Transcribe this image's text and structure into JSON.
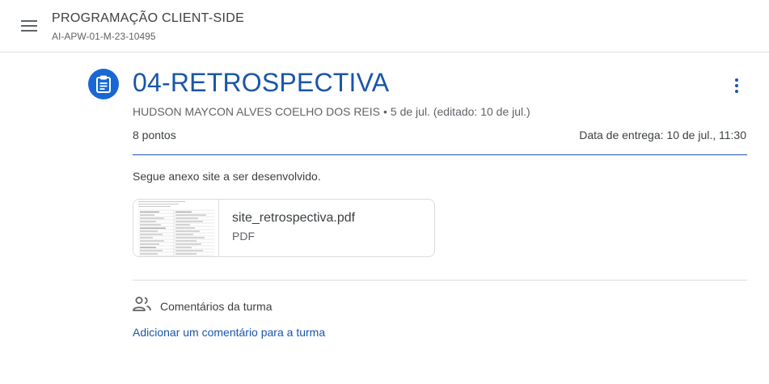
{
  "header": {
    "course_title": "PROGRAMAÇÃO CLIENT-SIDE",
    "course_code": "AI-APW-01-M-23-10495",
    "menu_icon": "hamburger-menu-icon"
  },
  "assignment": {
    "icon": "assignment-clipboard-icon",
    "title": "04-RETROSPECTIVA",
    "author": "HUDSON MAYCON ALVES COELHO DOS REIS",
    "separator": "•",
    "date": "5 de jul. (editado: 10 de jul.)",
    "points": "8 pontos",
    "due": "Data de entrega: 10 de jul., 11:30",
    "description": "Segue anexo site a ser desenvolvido."
  },
  "attachment": {
    "name": "site_retrospectiva.pdf",
    "type": "PDF"
  },
  "comments": {
    "icon": "people-icon",
    "label": "Comentários da turma",
    "add_link": "Adicionar um comentário para a turma"
  },
  "colors": {
    "accent": "#1967d2",
    "title": "#1a56a8",
    "text": "#3c4043",
    "muted": "#5f6368"
  }
}
